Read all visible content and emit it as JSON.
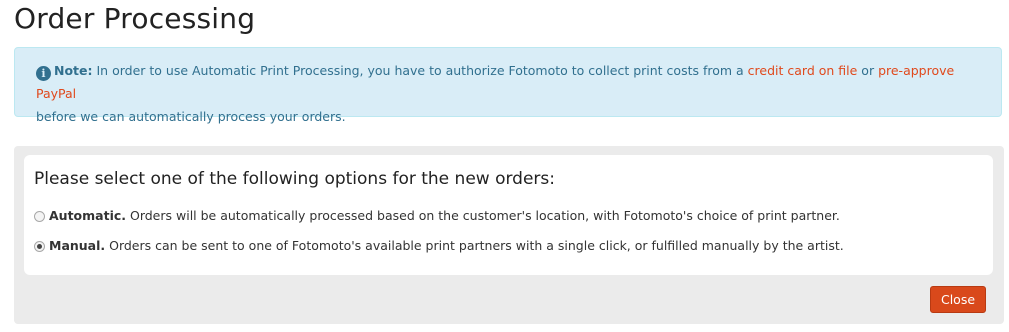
{
  "page": {
    "title": "Order Processing"
  },
  "alert": {
    "icon": "info-circle-icon",
    "note_label": "Note:",
    "text_before": " In order to use Automatic Print Processing, you have to authorize Fotomoto to collect print costs from a ",
    "link_credit_card": "credit card on file",
    "text_or": " or ",
    "link_paypal": "pre-approve PayPal",
    "text_after": "before we can automatically process your orders."
  },
  "options": {
    "heading": "Please select one of the following options for the new orders:",
    "selected": "manual",
    "items": [
      {
        "id": "automatic",
        "title": "Automatic.",
        "description": " Orders will be automatically processed based on the customer's location, with Fotomoto's choice of print partner."
      },
      {
        "id": "manual",
        "title": "Manual.",
        "description": " Orders can be sent to one of Fotomoto's available print partners with a single click, or fulfilled manually by the artist."
      }
    ]
  },
  "actions": {
    "close_label": "Close"
  },
  "colors": {
    "alert_bg": "#d9edf7",
    "alert_text": "#31708f",
    "link": "#e0491c",
    "button_bg": "#d9491b",
    "panel_bg": "#ebebeb"
  }
}
